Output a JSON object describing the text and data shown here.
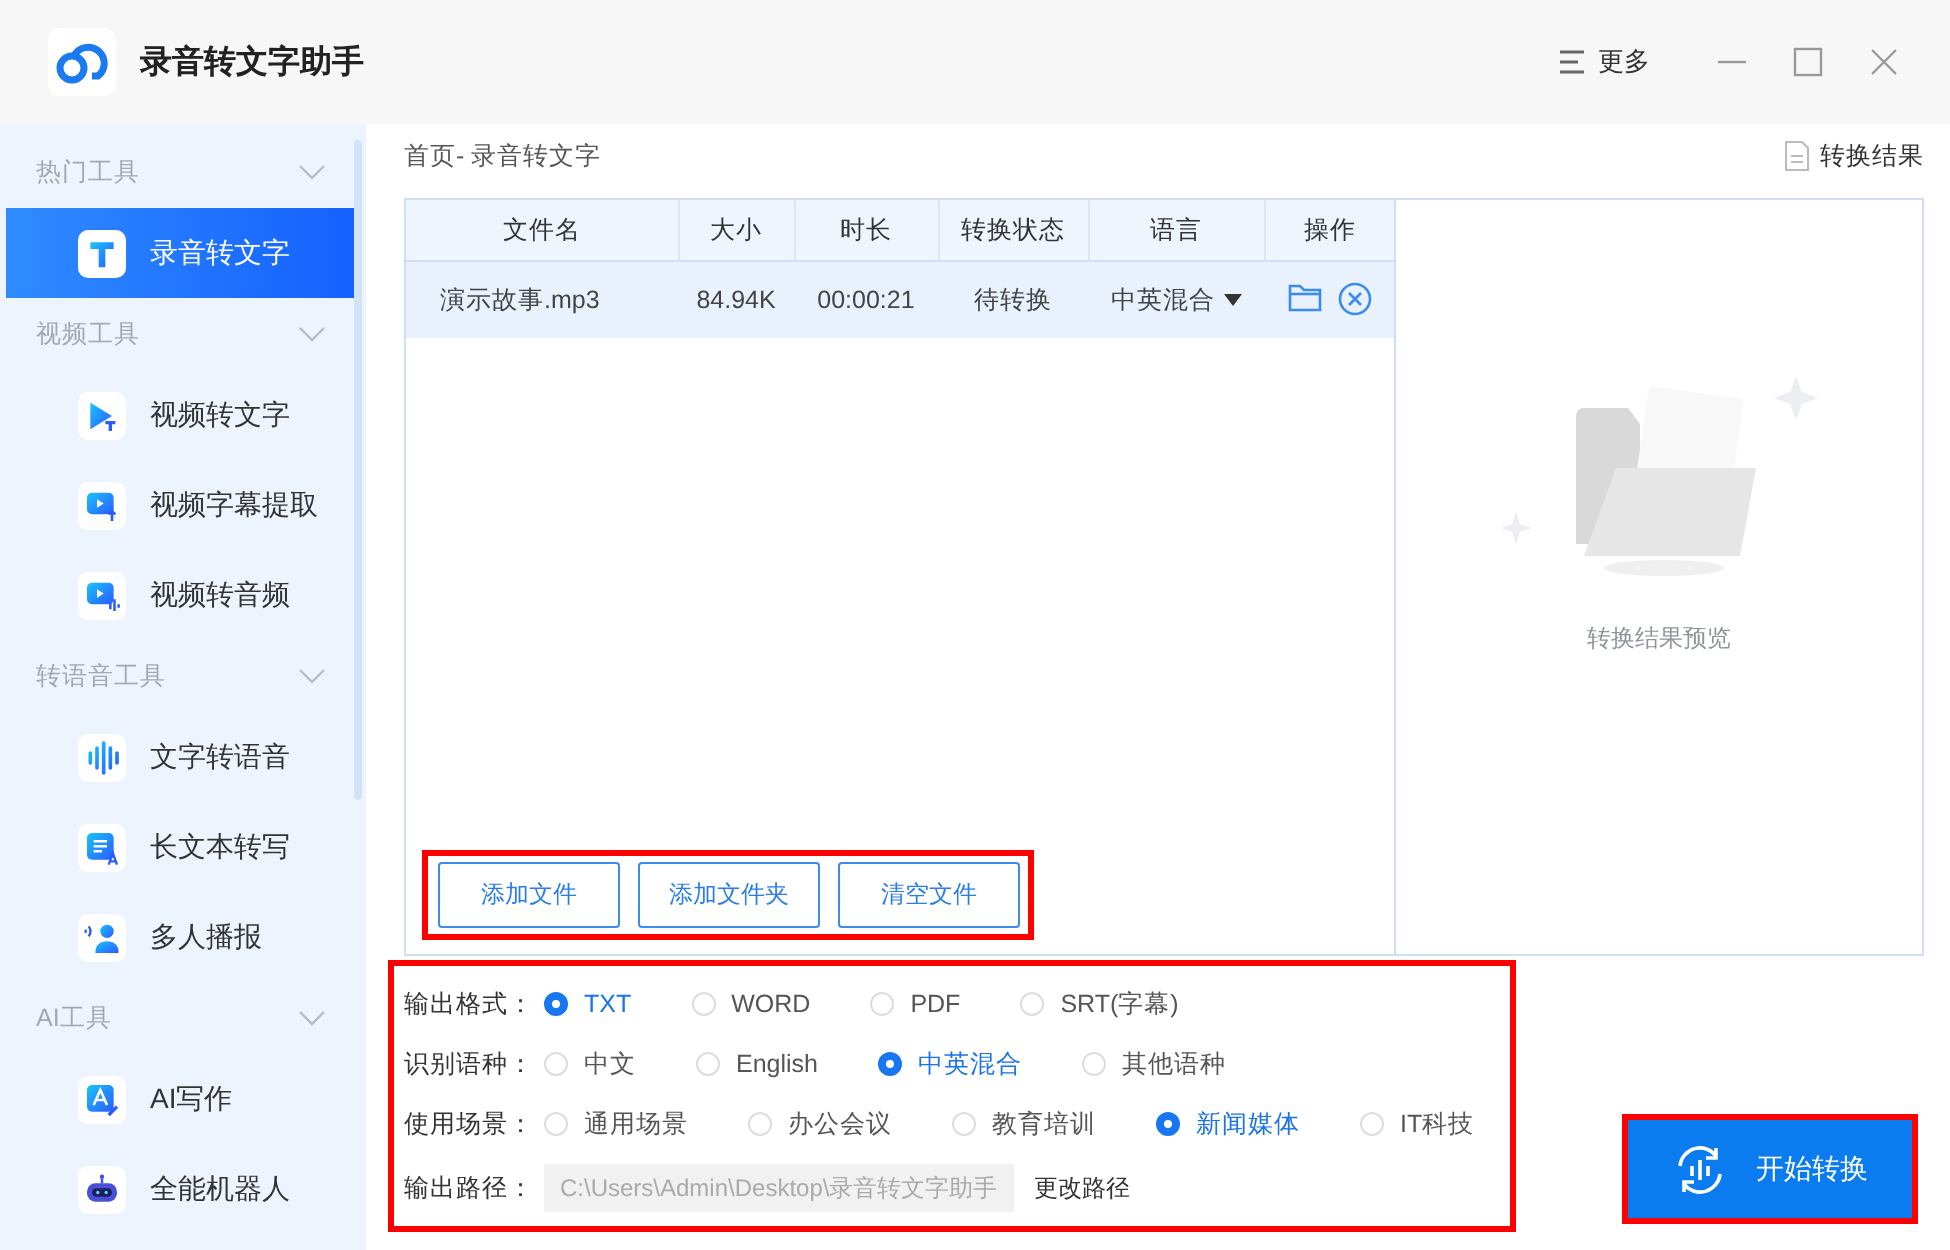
{
  "window": {
    "title": "录音转文字助手",
    "more": "更多"
  },
  "sidebar": {
    "sections": [
      {
        "title": "热门工具",
        "expanded": true,
        "items": [
          {
            "label": "录音转文字",
            "selected": true
          }
        ]
      },
      {
        "title": "视频工具",
        "expanded": true,
        "items": [
          {
            "label": "视频转文字",
            "selected": false
          },
          {
            "label": "视频字幕提取",
            "selected": false
          },
          {
            "label": "视频转音频",
            "selected": false
          }
        ]
      },
      {
        "title": "转语音工具",
        "expanded": true,
        "items": [
          {
            "label": "文字转语音",
            "selected": false
          },
          {
            "label": "长文本转写",
            "selected": false
          },
          {
            "label": "多人播报",
            "selected": false
          }
        ]
      },
      {
        "title": "AI工具",
        "expanded": true,
        "items": [
          {
            "label": "AI写作",
            "selected": false
          },
          {
            "label": "全能机器人",
            "selected": false
          }
        ]
      }
    ]
  },
  "breadcrumb": "首页- 录音转文字",
  "result_link": "转换结果",
  "table": {
    "columns": [
      "文件名",
      "大小",
      "时长",
      "转换状态",
      "语言",
      "操作"
    ],
    "rows": [
      {
        "name": "演示故事.mp3",
        "size": "84.94K",
        "duration": "00:00:21",
        "status": "待转换",
        "language": "中英混合"
      }
    ]
  },
  "file_buttons": {
    "highlighted": true,
    "items": [
      "添加文件",
      "添加文件夹",
      "清空文件"
    ]
  },
  "preview": {
    "text": "转换结果预览"
  },
  "options": {
    "highlighted": true,
    "groups": [
      {
        "label": "输出格式：",
        "choices": [
          {
            "label": "TXT",
            "selected": true
          },
          {
            "label": "WORD",
            "selected": false
          },
          {
            "label": "PDF",
            "selected": false
          },
          {
            "label": "SRT(字幕)",
            "selected": false
          }
        ]
      },
      {
        "label": "识别语种：",
        "choices": [
          {
            "label": "中文",
            "selected": false
          },
          {
            "label": "English",
            "selected": false
          },
          {
            "label": "中英混合",
            "selected": true
          },
          {
            "label": "其他语种",
            "selected": false
          }
        ]
      },
      {
        "label": "使用场景：",
        "choices": [
          {
            "label": "通用场景",
            "selected": false
          },
          {
            "label": "办公会议",
            "selected": false
          },
          {
            "label": "教育培训",
            "selected": false
          },
          {
            "label": "新闻媒体",
            "selected": true
          },
          {
            "label": "IT科技",
            "selected": false
          }
        ]
      }
    ],
    "path": {
      "label": "输出路径：",
      "value": "C:\\Users\\Admin\\Desktop\\录音转文字助手",
      "button": "更改路径"
    }
  },
  "start_button": {
    "label": "开始转换",
    "highlighted": true
  }
}
